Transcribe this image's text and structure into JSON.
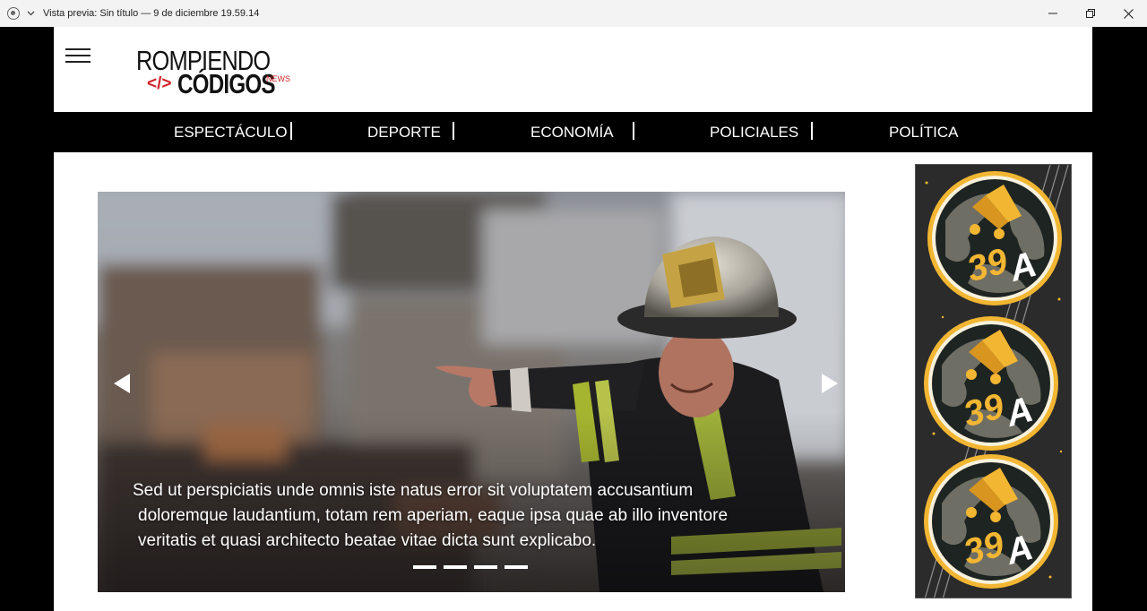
{
  "window": {
    "title": "Vista previa: Sin título — 9 de diciembre 19.59.14",
    "controls": {
      "minimize_icon": "minimize-icon",
      "restore_icon": "restore-icon",
      "close_icon": "close-icon"
    }
  },
  "logo": {
    "line1": "ROMPIENDO",
    "code_symbol": "</>",
    "line2": "CÓDIGOS",
    "news": "NEWS"
  },
  "nav": {
    "items": [
      {
        "label": "ESPECTÁCULO"
      },
      {
        "label": "DEPORTE"
      },
      {
        "label": "ECONOMÍA"
      },
      {
        "label": "POLICIALES"
      },
      {
        "label": "POLÍTICA"
      }
    ]
  },
  "carousel": {
    "caption": {
      "line1": "Sed ut perspiciatis unde omnis iste natus error sit voluptatem accusantium",
      "line2": "doloremque laudantium, totam rem aperiam, eaque ipsa quae ab illo inventore",
      "line3": "veritatis et quasi architecto beatae vitae dicta sunt explicabo."
    },
    "slide_count": 4,
    "prev_icon": "triangle-left-icon",
    "next_icon": "triangle-right-icon"
  },
  "ad": {
    "badge_text": "39A",
    "badge_count": 3
  },
  "colors": {
    "accent_red": "#d0242a",
    "nav_bg": "#000000",
    "ad_gold": "#f2b632"
  }
}
